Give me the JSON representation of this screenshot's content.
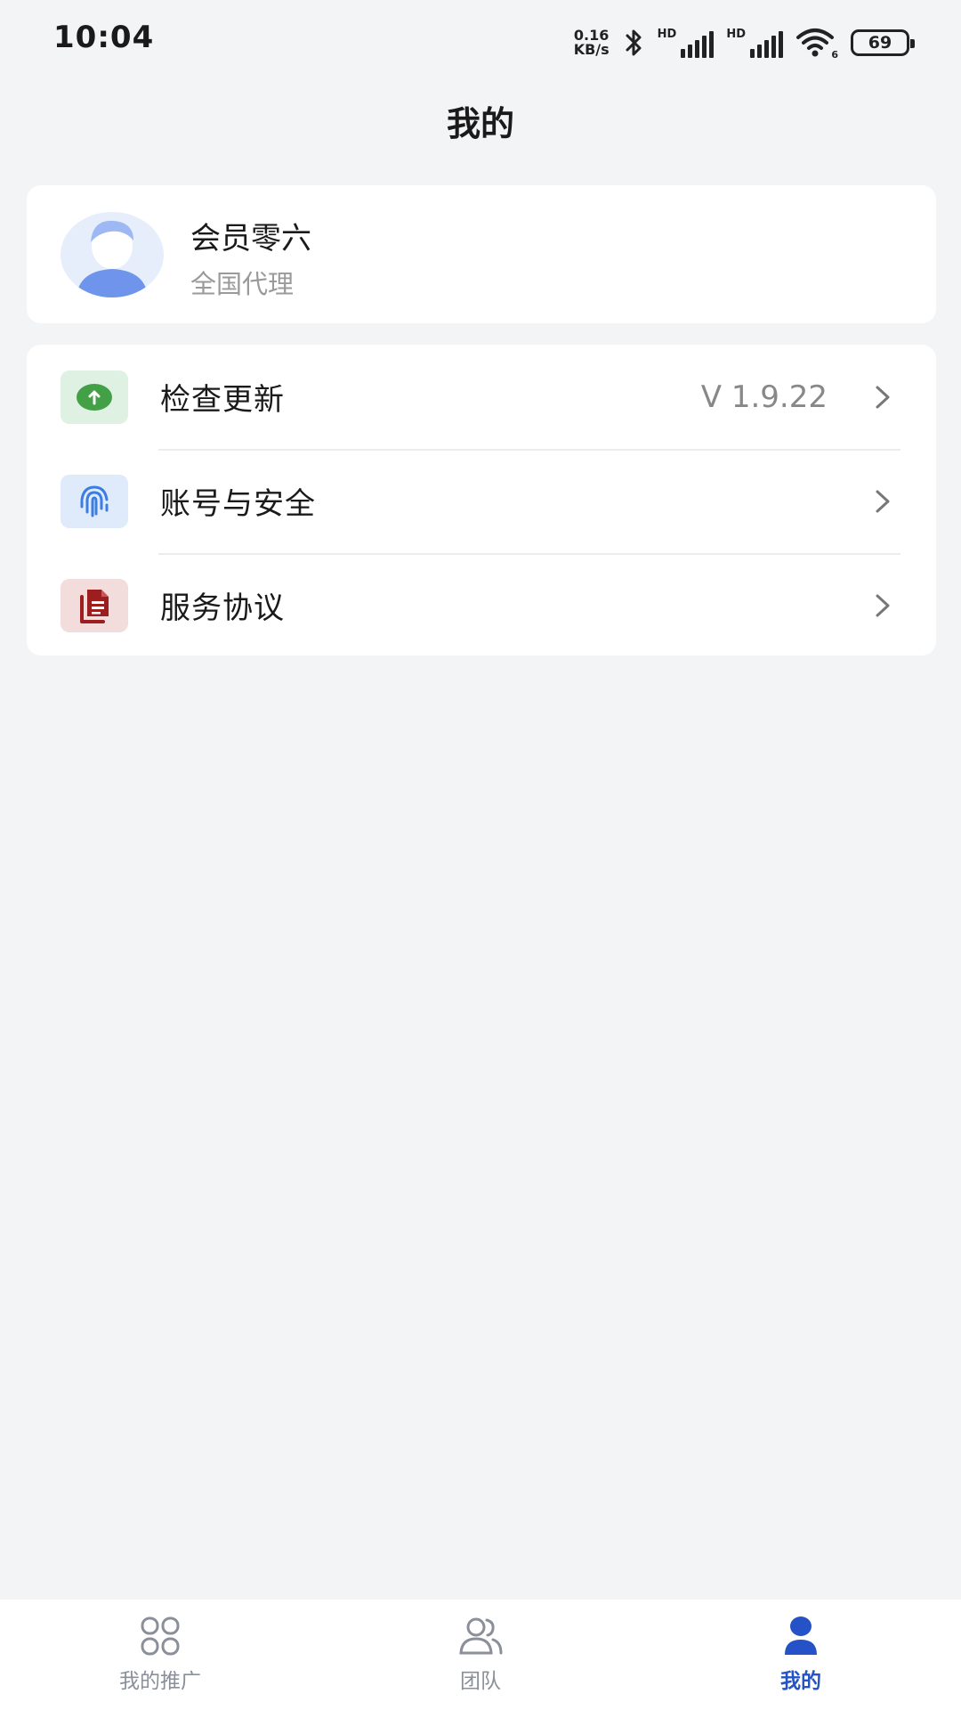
{
  "status_bar": {
    "time": "10:04",
    "net_speed_value": "0.16",
    "net_speed_unit": "KB/s",
    "sim1_label": "HD",
    "sim2_label": "HD",
    "wifi_badge": "6",
    "battery": "69"
  },
  "header": {
    "title": "我的"
  },
  "profile": {
    "name": "会员零六",
    "role": "全国代理",
    "avatar_icon": "user-avatar-icon"
  },
  "menu": {
    "items": [
      {
        "label": "检查更新",
        "value": "V 1.9.22",
        "icon": "upload-arrow-icon",
        "icon_color": "#43a047",
        "icon_bg": "#dff1e2"
      },
      {
        "label": "账号与安全",
        "value": "",
        "icon": "fingerprint-icon",
        "icon_color": "#3b7de0",
        "icon_bg": "#dfeafb"
      },
      {
        "label": "服务协议",
        "value": "",
        "icon": "document-icon",
        "icon_color": "#9c1e1e",
        "icon_bg": "#f3dcdc"
      }
    ]
  },
  "tab_bar": {
    "items": [
      {
        "label": "我的推广",
        "icon": "grid-apps-icon",
        "active": false
      },
      {
        "label": "团队",
        "icon": "team-users-icon",
        "active": false
      },
      {
        "label": "我的",
        "icon": "person-icon",
        "active": true
      }
    ],
    "active_color": "#2553c7",
    "inactive_color": "#8a8f99"
  }
}
